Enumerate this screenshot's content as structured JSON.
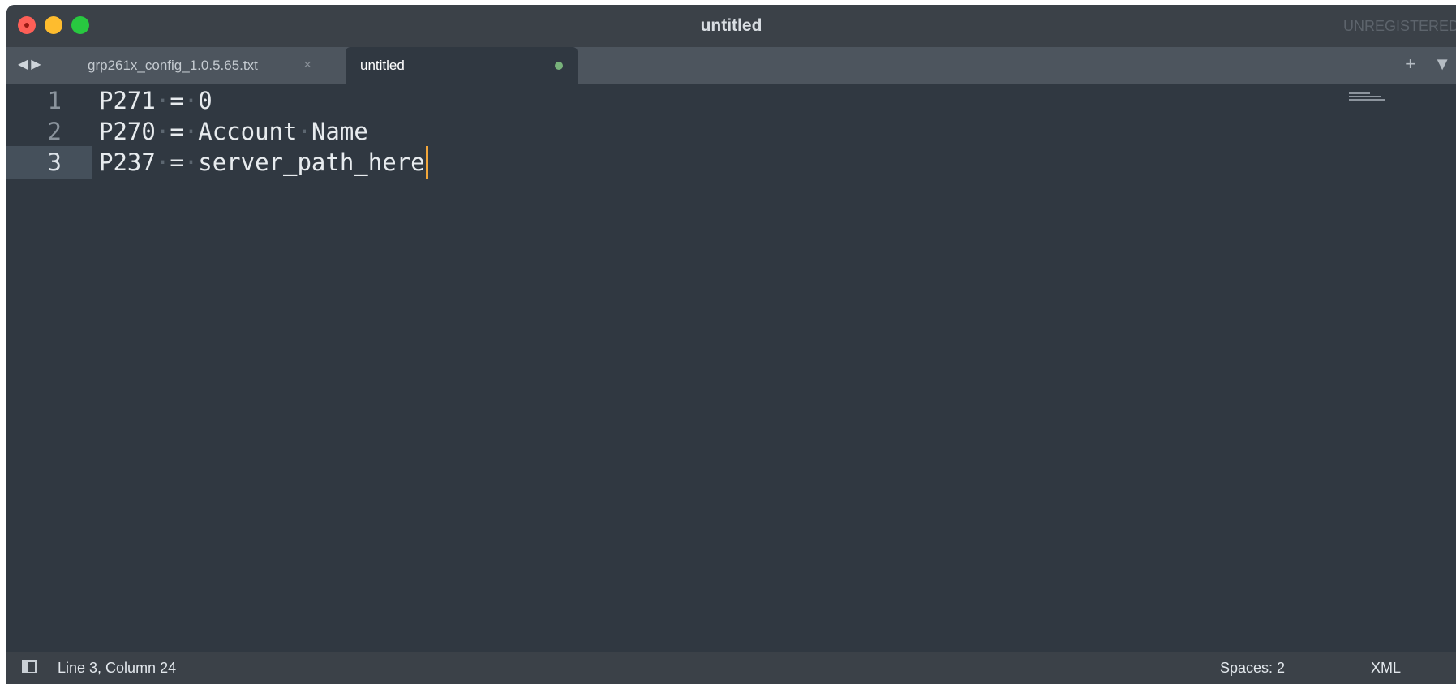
{
  "window": {
    "title": "untitled",
    "license_status": "UNREGISTERED"
  },
  "tabs": [
    {
      "label": "grp261x_config_1.0.5.65.txt",
      "active": false,
      "close_glyph": "×"
    },
    {
      "label": "untitled",
      "active": true,
      "dirty": true
    }
  ],
  "tab_bar": {
    "nav_glyph": "◀▶",
    "actions_glyph": "+ ▼"
  },
  "editor": {
    "lines": [
      {
        "number": "1",
        "parts": [
          "P271",
          "=",
          "0"
        ]
      },
      {
        "number": "2",
        "parts": [
          "P270",
          "=",
          "Account",
          "Name"
        ]
      },
      {
        "number": "3",
        "parts": [
          "P237",
          "=",
          "server_path_here"
        ],
        "current": true
      }
    ],
    "text": [
      "P271 = 0",
      "P270 = Account Name",
      "P237 = server_path_here"
    ]
  },
  "status_bar": {
    "cursor_position": "Line 3, Column 24",
    "indentation": "Spaces: 2",
    "syntax": "XML"
  },
  "colors": {
    "editor_background": "#303841",
    "caret": "#f3a73a",
    "dirty_indicator": "#78b27a"
  }
}
